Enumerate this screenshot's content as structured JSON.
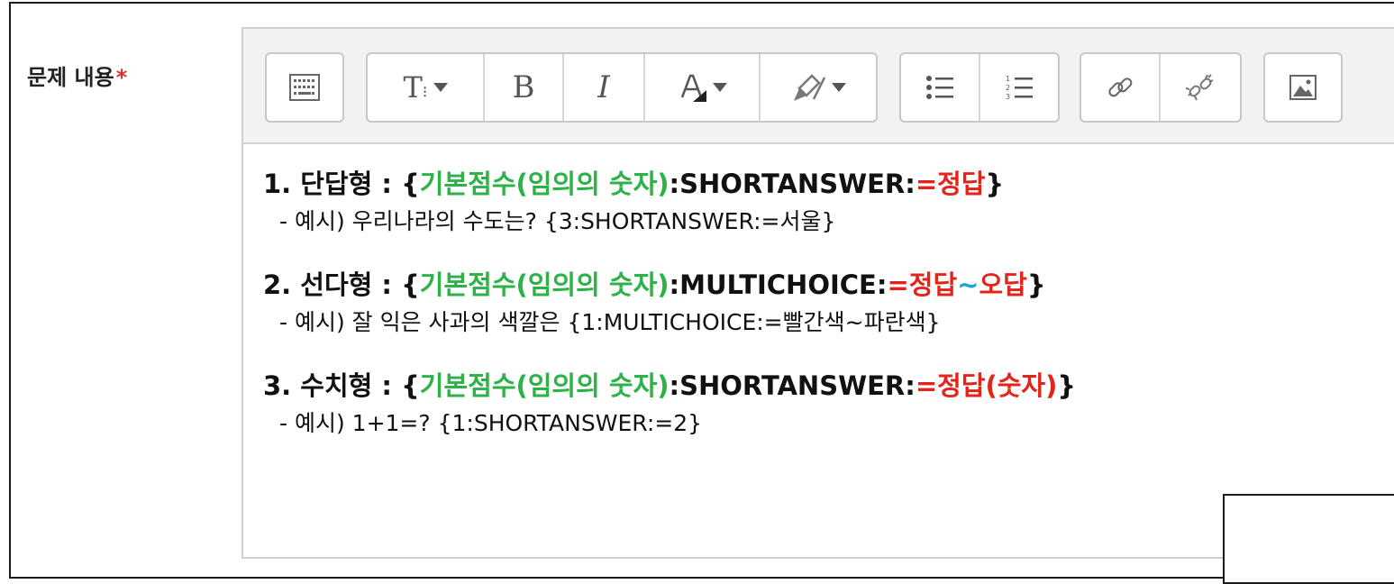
{
  "field": {
    "label": "문제 내용",
    "required_mark": "*"
  },
  "toolbar": {
    "icons": [
      "toolbar-toggle-icon",
      "font-size-icon",
      "bold-icon",
      "italic-icon",
      "font-color-icon",
      "highlight-icon",
      "bullet-list-icon",
      "numbered-list-icon",
      "link-icon",
      "unlink-icon",
      "image-icon"
    ],
    "bold_label": "B",
    "italic_label": "I",
    "font_size_label": "T"
  },
  "content": {
    "rules": [
      {
        "prefix": "1. 단답형 : {",
        "green": "기본점수(임의의 숫자)",
        "middle": ":SHORTANSWER:",
        "red": "=정답",
        "suffix": "}",
        "example": "- 예시)  우리나라의 수도는? {3:SHORTANSWER:=서울}"
      },
      {
        "prefix": "2. 선다형 : {",
        "green": "기본점수(임의의 숫자)",
        "middle": ":MULTICHOICE:",
        "red": "=정답",
        "tilde": "~",
        "red2": "오답",
        "suffix": "}",
        "example": "- 예시)  잘 익은 사과의 색깔은 {1:MULTICHOICE:=빨간색~파란색}"
      },
      {
        "prefix": "3. 수치형 : {",
        "green": "기본점수(임의의 숫자)",
        "middle": ":SHORTANSWER:",
        "red": "=정답(숫자)",
        "suffix": "}",
        "example": "- 예시)  1+1=? {1:SHORTANSWER:=2}"
      }
    ]
  },
  "colors": {
    "green": "#2db24a",
    "red": "#e3241b",
    "tilde": "#1aa3d9",
    "required": "#d9302c"
  }
}
